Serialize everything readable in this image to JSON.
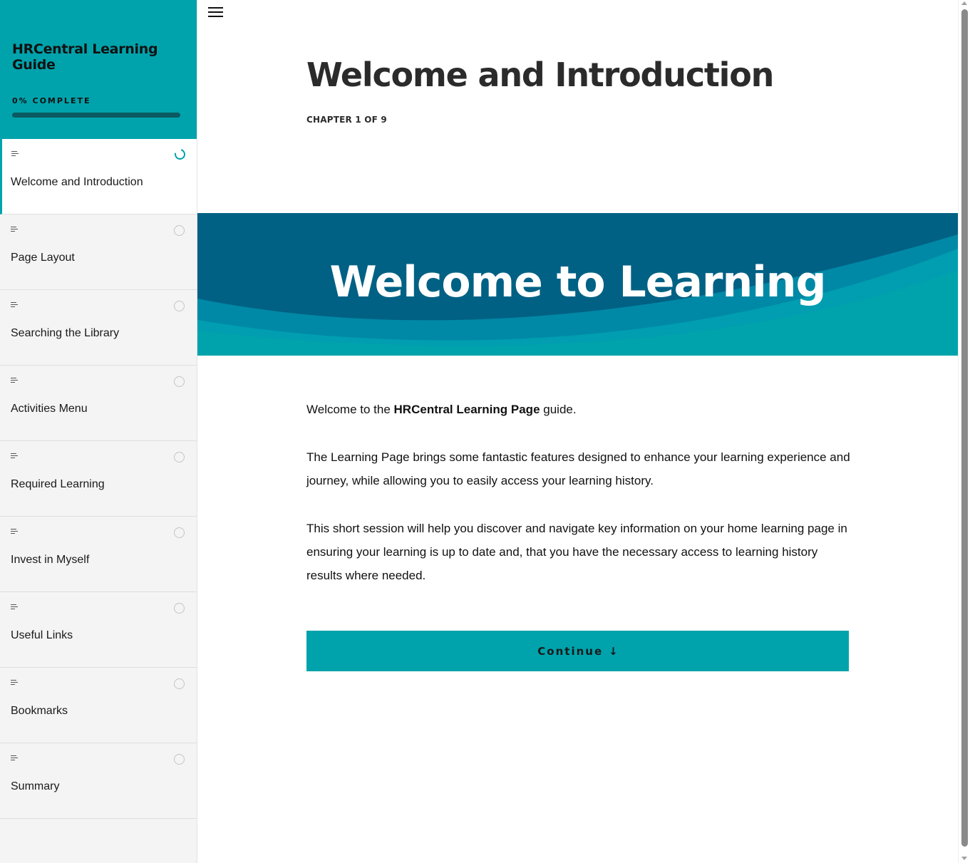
{
  "sidebar": {
    "course_title": "HRCentral Learning Guide",
    "progress_label": "0% COMPLETE",
    "progress_fraction": 0,
    "items": [
      {
        "label": "Welcome and Introduction",
        "status": "in-progress"
      },
      {
        "label": "Page Layout",
        "status": "not-started"
      },
      {
        "label": "Searching the Library",
        "status": "not-started"
      },
      {
        "label": "Activities Menu",
        "status": "not-started"
      },
      {
        "label": "Required Learning",
        "status": "not-started"
      },
      {
        "label": "Invest in Myself",
        "status": "not-started"
      },
      {
        "label": "Useful Links",
        "status": "not-started"
      },
      {
        "label": "Bookmarks",
        "status": "not-started"
      },
      {
        "label": "Summary",
        "status": "not-started"
      }
    ]
  },
  "main": {
    "menu_icon": "hamburger-menu-icon",
    "lesson_title": "Welcome and Introduction",
    "chapter_label": "CHAPTER 1 OF 9",
    "banner_text": "Welcome to Learning",
    "intro": {
      "before": "Welcome to the ",
      "bold": "HRCentral Learning Page",
      "after": " guide."
    },
    "paragraph_2": "The Learning Page brings some fantastic features designed to enhance your learning experience and journey, while allowing you to easily access your learning history.",
    "paragraph_3": "This short session will help you discover and navigate key information on your home learning page in ensuring your learning is up to date and, that you have the necessary access to learning history results where needed.",
    "continue_label": "Continue",
    "continue_icon": "arrow-down-icon"
  },
  "colors": {
    "accent": "#00a3ac",
    "banner_dark": "#006184",
    "banner_mid": "#0089a6"
  }
}
